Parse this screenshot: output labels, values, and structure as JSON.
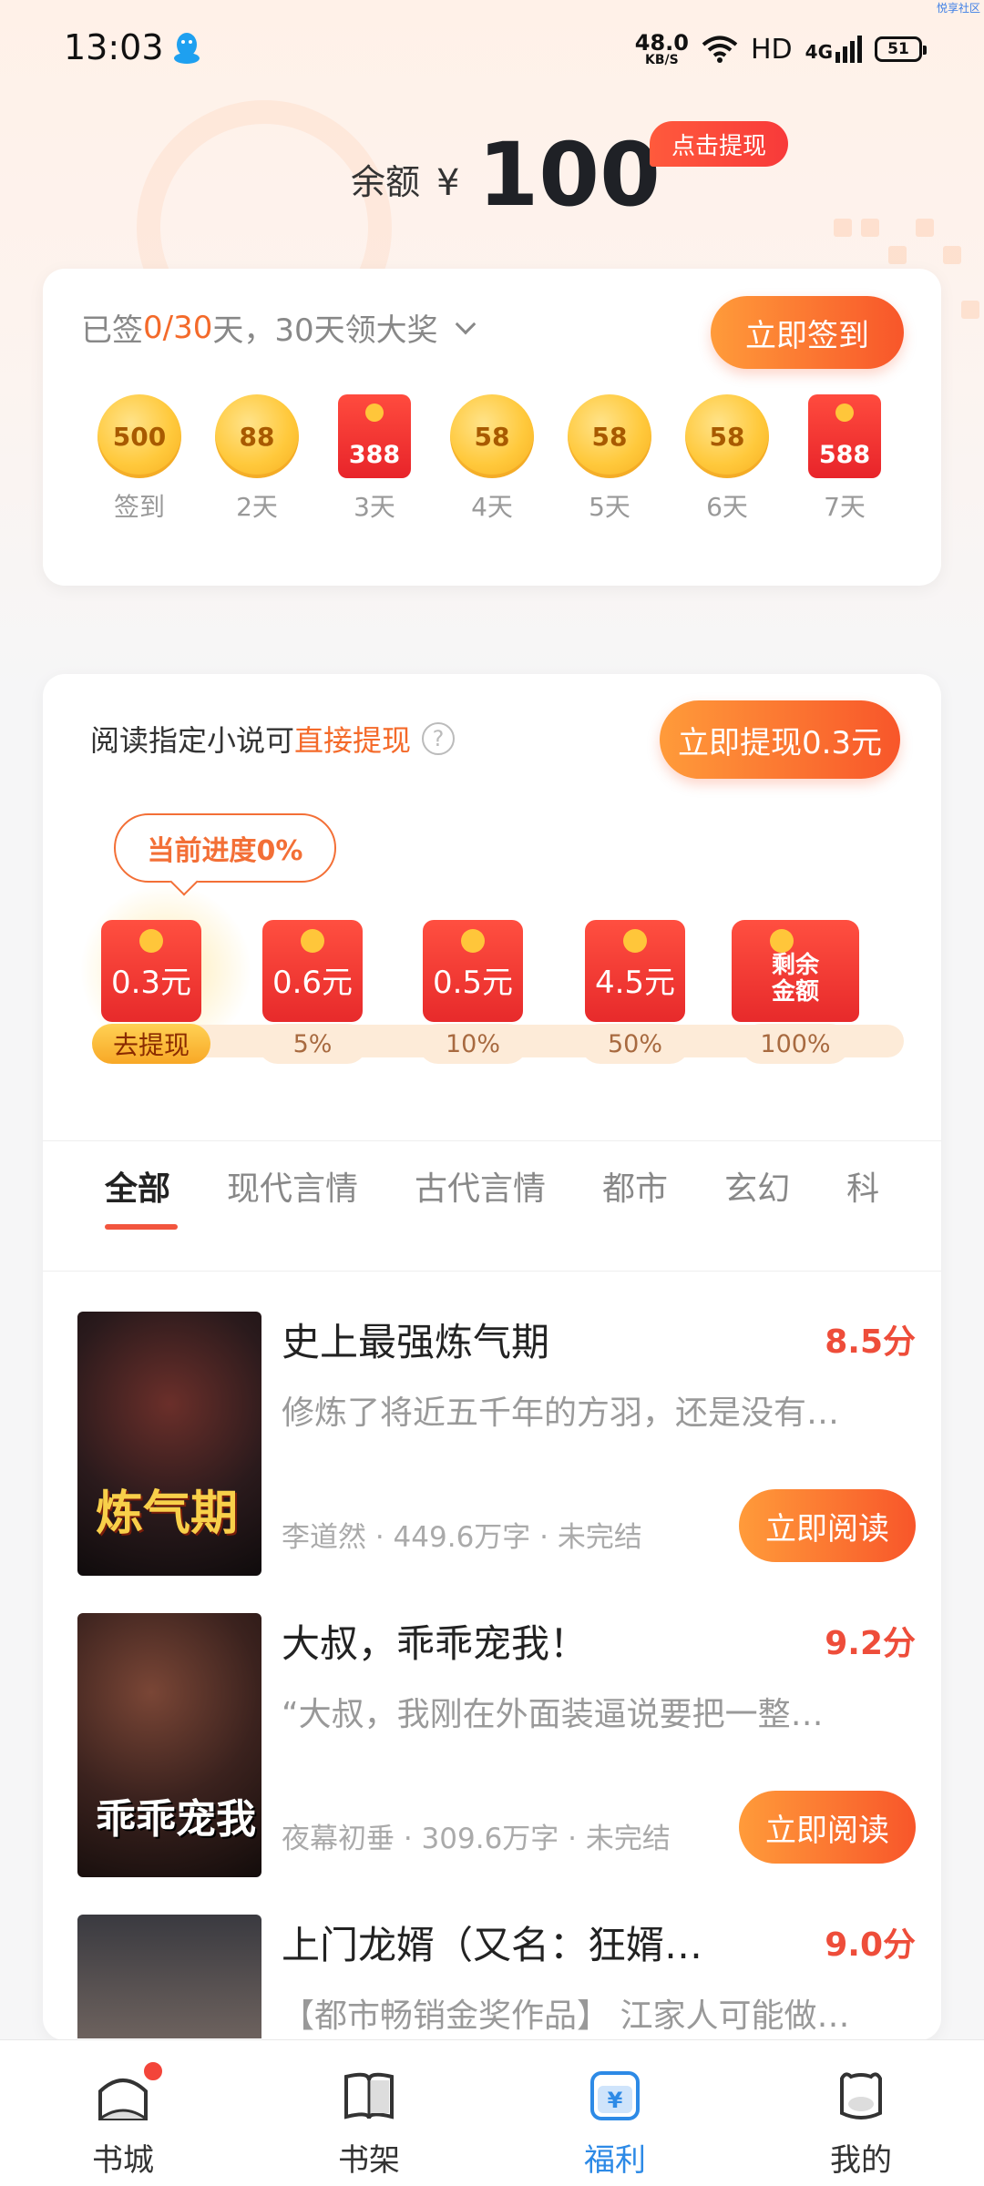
{
  "status_bar": {
    "time": "13:03",
    "net_speed_value": "48.0",
    "net_speed_unit": "KB/S",
    "hd": "HD",
    "signal": "4G",
    "battery": "51",
    "corner_tag": "悦享社区"
  },
  "balance": {
    "label": "余额",
    "currency": "¥",
    "amount": "100",
    "withdraw_bubble": "点击提现"
  },
  "signin": {
    "text_prefix": "已签",
    "progress": "0/30",
    "text_suffix": "天，30天领大奖",
    "button": "立即签到",
    "days": [
      {
        "value": "500",
        "label": "签到",
        "type": "coin"
      },
      {
        "value": "88",
        "label": "2天",
        "type": "coin"
      },
      {
        "value": "388",
        "label": "3天",
        "type": "redpack"
      },
      {
        "value": "58",
        "label": "4天",
        "type": "coin"
      },
      {
        "value": "58",
        "label": "5天",
        "type": "coin"
      },
      {
        "value": "58",
        "label": "6天",
        "type": "coin"
      },
      {
        "value": "588",
        "label": "7天",
        "type": "redpack"
      }
    ]
  },
  "reading_reward": {
    "title_prefix": "阅读指定小说可",
    "title_highlight": "直接提现",
    "help_icon": "?",
    "button": "立即提现0.3元",
    "progress_bubble": "当前进度0%",
    "progress_percent": 0,
    "milestones": [
      {
        "amount": "0.3元",
        "label": "去提现"
      },
      {
        "amount": "0.6元",
        "label": "5%"
      },
      {
        "amount": "0.5元",
        "label": "10%"
      },
      {
        "amount": "4.5元",
        "label": "50%"
      },
      {
        "amount_line1": "剩余",
        "amount_line2": "金额",
        "label": "100%"
      }
    ]
  },
  "tabs": [
    "全部",
    "现代言情",
    "古代言情",
    "都市",
    "玄幻",
    "科"
  ],
  "books": [
    {
      "title": "史上最强炼气期",
      "score": "8.5分",
      "desc": "修炼了将近五千年的方羽，还是没有…",
      "meta": "李道然 · 449.6万字 · 未完结",
      "button": "立即阅读",
      "cover_text": "炼气期"
    },
    {
      "title": "大叔，乖乖宠我！",
      "score": "9.2分",
      "desc": "“大叔，我刚在外面装逼说要把一整…",
      "meta": "夜幕初垂 · 309.6万字 · 未完结",
      "button": "立即阅读",
      "cover_text": "乖乖宠我"
    },
    {
      "title": "上门龙婿（又名：狂婿…",
      "score": "9.0分",
      "desc": "【都市畅销金奖作品】 江家人可能做…",
      "meta": "",
      "button": "",
      "cover_text": ""
    }
  ],
  "bottom_nav": [
    {
      "label": "书城",
      "icon": "bookstore-icon"
    },
    {
      "label": "书架",
      "icon": "bookshelf-icon"
    },
    {
      "label": "福利",
      "icon": "welfare-icon",
      "active": true
    },
    {
      "label": "我的",
      "icon": "profile-icon"
    }
  ],
  "colors": {
    "accent_orange": "#f8562a",
    "score_red": "#ee4d3a",
    "nav_active": "#2d8ae6"
  }
}
